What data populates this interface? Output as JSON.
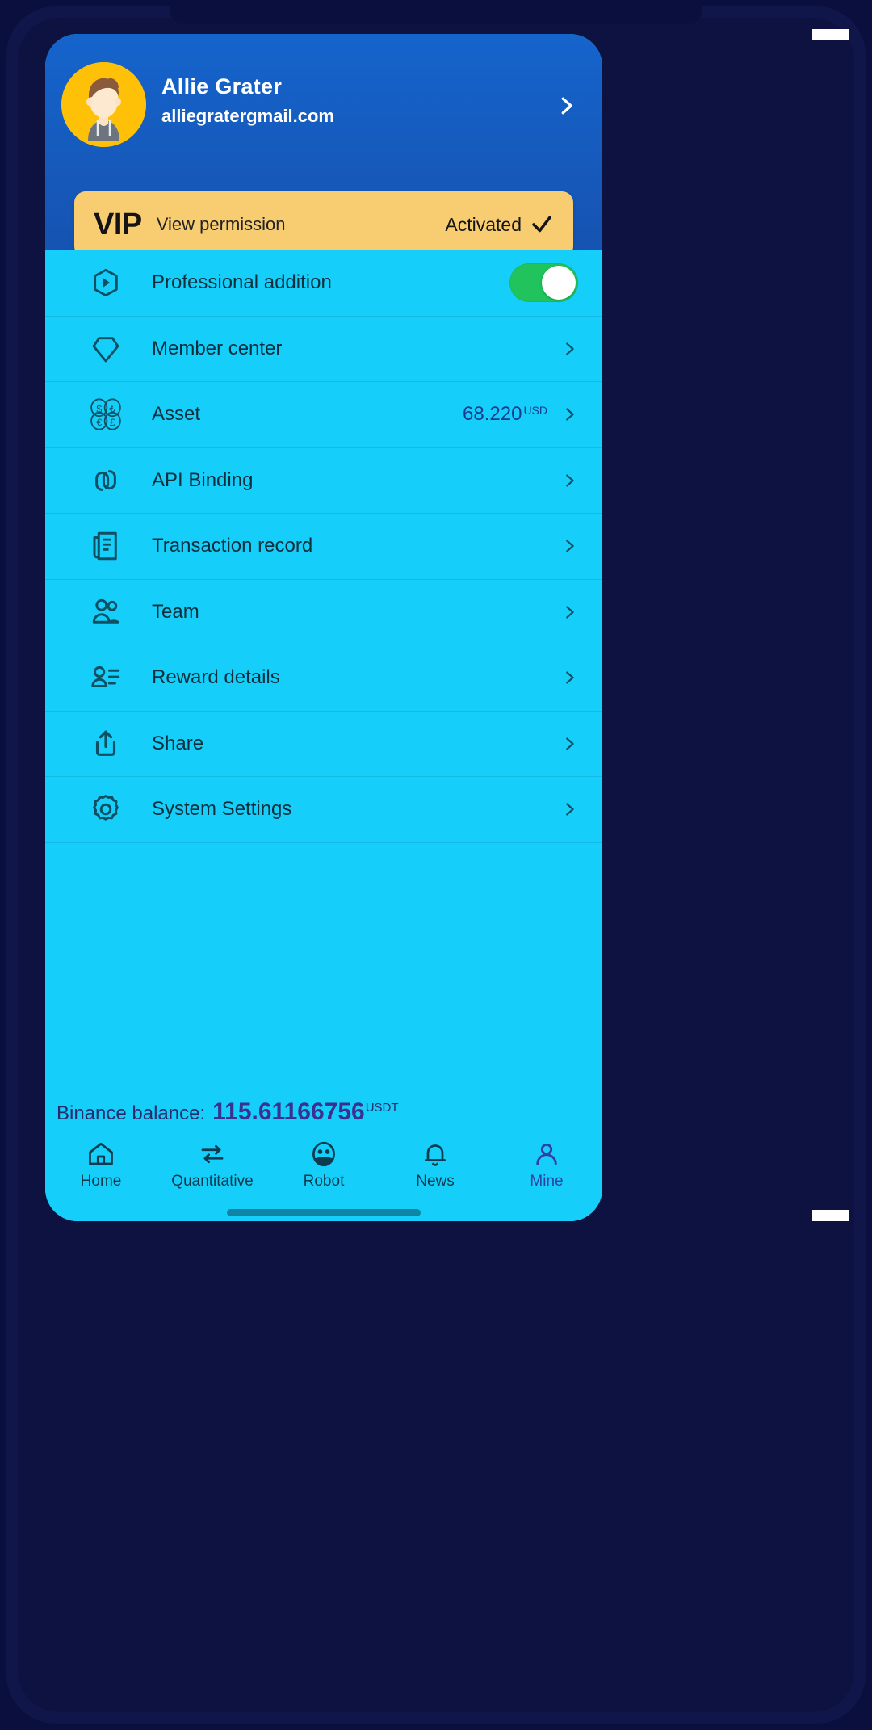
{
  "profile": {
    "name": "Allie Grater",
    "email": "alliegratergmail.com",
    "chevron_icon": "chevron-right-icon",
    "avatar_icon": "user-avatar-icon"
  },
  "vip": {
    "badge": "VIP",
    "description": "View permission",
    "status": "Activated",
    "check_icon": "check-icon",
    "background_color": "#f8cd71"
  },
  "menu": [
    {
      "label": "Professional addition",
      "icon": "hexagon-play-icon",
      "control": "toggle",
      "toggle_on": true
    },
    {
      "label": "Member center",
      "icon": "diamond-icon",
      "control": "chevron"
    },
    {
      "label": "Asset",
      "icon": "coins-currency-icon",
      "control": "chevron",
      "value": "68.220",
      "unit": "USD"
    },
    {
      "label": "API Binding",
      "icon": "link-chain-icon",
      "control": "chevron"
    },
    {
      "label": "Transaction record",
      "icon": "receipt-document-icon",
      "control": "chevron"
    },
    {
      "label": "Team",
      "icon": "users-group-icon",
      "control": "chevron"
    },
    {
      "label": "Reward details",
      "icon": "user-list-icon",
      "control": "chevron"
    },
    {
      "label": "Share",
      "icon": "share-upload-icon",
      "control": "chevron"
    },
    {
      "label": "System Settings",
      "icon": "gear-icon",
      "control": "chevron"
    }
  ],
  "balance": {
    "label": "Binance balance:",
    "value": "115.61166756",
    "unit": "USDT"
  },
  "bottom_nav": {
    "active": "Mine",
    "items": [
      {
        "label": "Home",
        "icon": "home-icon"
      },
      {
        "label": "Quantitative",
        "icon": "exchange-arrows-icon"
      },
      {
        "label": "Robot",
        "icon": "robot-face-icon"
      },
      {
        "label": "News",
        "icon": "bell-icon"
      },
      {
        "label": "Mine",
        "icon": "person-icon"
      }
    ]
  },
  "colors": {
    "header_blue": "#1564cc",
    "panel_cyan": "#15cffa",
    "vip_gold": "#f8cd71",
    "toggle_green": "#21c45c",
    "accent_purple": "#3b2f8f",
    "frame_navy": "#0b0f3d"
  }
}
